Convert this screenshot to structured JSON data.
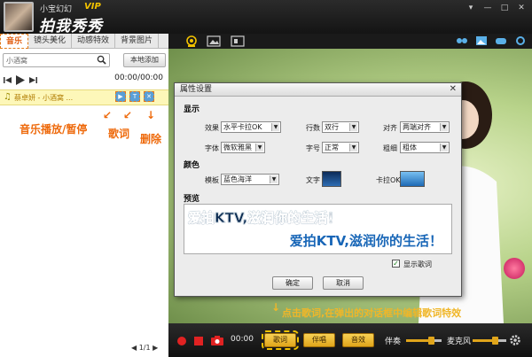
{
  "header": {
    "username": "小宝幻幻",
    "vip": "VIP",
    "app_name": "拍我秀秀",
    "window_buttons": [
      "▾",
      "—",
      "□",
      "✕"
    ]
  },
  "left_panel": {
    "tabs": [
      {
        "label": "音乐",
        "active": true
      },
      {
        "label": "镜头美化",
        "active": false
      },
      {
        "label": "动感特效",
        "active": false
      },
      {
        "label": "背景图片",
        "active": false
      }
    ],
    "search": {
      "value": "小酒窝",
      "icon": "search-icon"
    },
    "local_add": "本地添加",
    "time": "00:00/00:00",
    "song": {
      "title": "蔡卓妍 - 小酒窝 ..."
    },
    "song_buttons": [
      "▶",
      "T",
      "✕"
    ],
    "annotations": {
      "play": "音乐播放/暂停",
      "lyrics": "歌词",
      "delete": "删除"
    },
    "pager": "◀ 1/1 ▶"
  },
  "dialog": {
    "title": "属性设置",
    "sections": {
      "display": "显示",
      "color": "颜色",
      "preview": "预览"
    },
    "fields": {
      "effect": {
        "label": "效果",
        "value": "水平卡拉OK"
      },
      "lines": {
        "label": "行数",
        "value": "双行"
      },
      "align": {
        "label": "对齐",
        "value": "两端对齐"
      },
      "font": {
        "label": "字体",
        "value": "微软雅黑"
      },
      "size": {
        "label": "字号",
        "value": "正常"
      },
      "weight": {
        "label": "粗细",
        "value": "粗体"
      },
      "template": {
        "label": "模板",
        "value": "蓝色海洋"
      },
      "text": {
        "label": "文字"
      },
      "karaoke": {
        "label": "卡拉OK"
      }
    },
    "preview_lines": [
      "爱拍KTV,滋润你的生活！",
      "爱拍KTV,滋润你的生活！"
    ],
    "show_lyrics": {
      "label": "显示歌词",
      "checked": true
    },
    "ok": "确定",
    "cancel": "取消",
    "colors": {
      "text_swatch": "#1a4e86",
      "karaoke_swatch": "#3a8fd8"
    }
  },
  "bottom_annotation": "点击歌词,在弹出的对话框中编辑歌词特效",
  "bottombar": {
    "time": "00:00",
    "buttons": [
      {
        "label": "歌词",
        "highlighted": true
      },
      {
        "label": "伴唱",
        "highlighted": false
      },
      {
        "label": "音效",
        "highlighted": false
      }
    ],
    "accompaniment": "伴奏",
    "microphone": "麦克风",
    "accompaniment_level": 0.75,
    "microphone_level": 0.7
  }
}
